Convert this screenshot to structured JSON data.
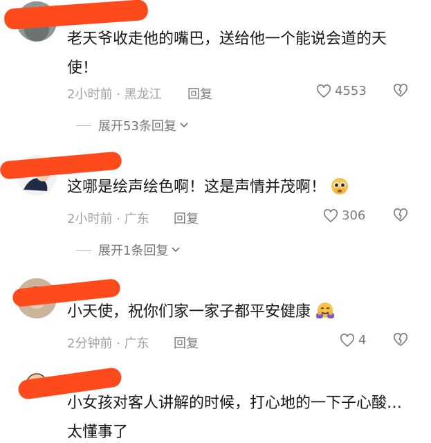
{
  "comments": [
    {
      "text": "老天爷收走他的嘴巴，送给他一个能说会道的天使！",
      "time": "2小时前",
      "location": "黑龙江",
      "reply_label": "回复",
      "likes": "4553",
      "expand_label": "展开53条回复"
    },
    {
      "text": "这哪是绘声绘色啊！这是声情并茂啊！",
      "time": "2小时前",
      "location": "广东",
      "reply_label": "回复",
      "likes": "306",
      "expand_label": "展开1条回复"
    },
    {
      "text": "小天使，祝你们家一家子都平安健康",
      "time": "2分钟前",
      "location": "广东",
      "reply_label": "回复",
      "likes": "4"
    },
    {
      "text": "小女孩对客人讲解的时候，打心地的一下子心酸…太懂事了"
    }
  ],
  "separator": " · ",
  "colors": {
    "redaction": "#ff4a1c",
    "text": "#161616",
    "meta": "#a3a3a3"
  }
}
